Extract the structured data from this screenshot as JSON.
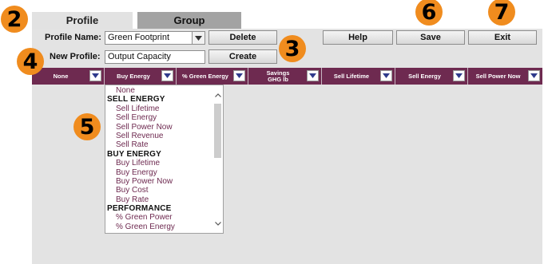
{
  "tabs": {
    "profile": "Profile",
    "group": "Group"
  },
  "form": {
    "profile_name_label": "Profile Name:",
    "profile_name_value": "Green Footprint",
    "new_profile_label": "New Profile:",
    "new_profile_value": "Output Capacity"
  },
  "buttons": {
    "delete": "Delete",
    "create": "Create",
    "help": "Help",
    "save": "Save",
    "exit": "Exit"
  },
  "callouts": {
    "c2": "2",
    "c3": "3",
    "c4": "4",
    "c5": "5",
    "c6": "6",
    "c7": "7"
  },
  "columns": [
    {
      "label": "None"
    },
    {
      "label": "Buy Energy"
    },
    {
      "label": "% Green Energy"
    },
    {
      "label": "Savings",
      "label2": "GHG lb"
    },
    {
      "label": "Sell Lifetime"
    },
    {
      "label": "Sell Energy"
    },
    {
      "label": "Sell Power Now"
    }
  ],
  "dropdown": {
    "items": [
      {
        "text": "None",
        "kind": "item"
      },
      {
        "text": "SELL ENERGY",
        "kind": "head"
      },
      {
        "text": "Sell Lifetime",
        "kind": "item"
      },
      {
        "text": "Sell Energy",
        "kind": "item"
      },
      {
        "text": "Sell Power Now",
        "kind": "item"
      },
      {
        "text": "Sell Revenue",
        "kind": "item"
      },
      {
        "text": "Sell Rate",
        "kind": "item"
      },
      {
        "text": "BUY ENERGY",
        "kind": "head"
      },
      {
        "text": "Buy Lifetime",
        "kind": "item"
      },
      {
        "text": "Buy Energy",
        "kind": "item"
      },
      {
        "text": "Buy Power Now",
        "kind": "item"
      },
      {
        "text": "Buy Cost",
        "kind": "item"
      },
      {
        "text": "Buy Rate",
        "kind": "item"
      },
      {
        "text": "PERFORMANCE",
        "kind": "head"
      },
      {
        "text": "% Green Power",
        "kind": "item"
      },
      {
        "text": "% Green Energy",
        "kind": "item"
      }
    ]
  },
  "colors": {
    "accent": "#6e2a50",
    "callout": "#f08c1e",
    "panel": "#e3e3e3"
  }
}
